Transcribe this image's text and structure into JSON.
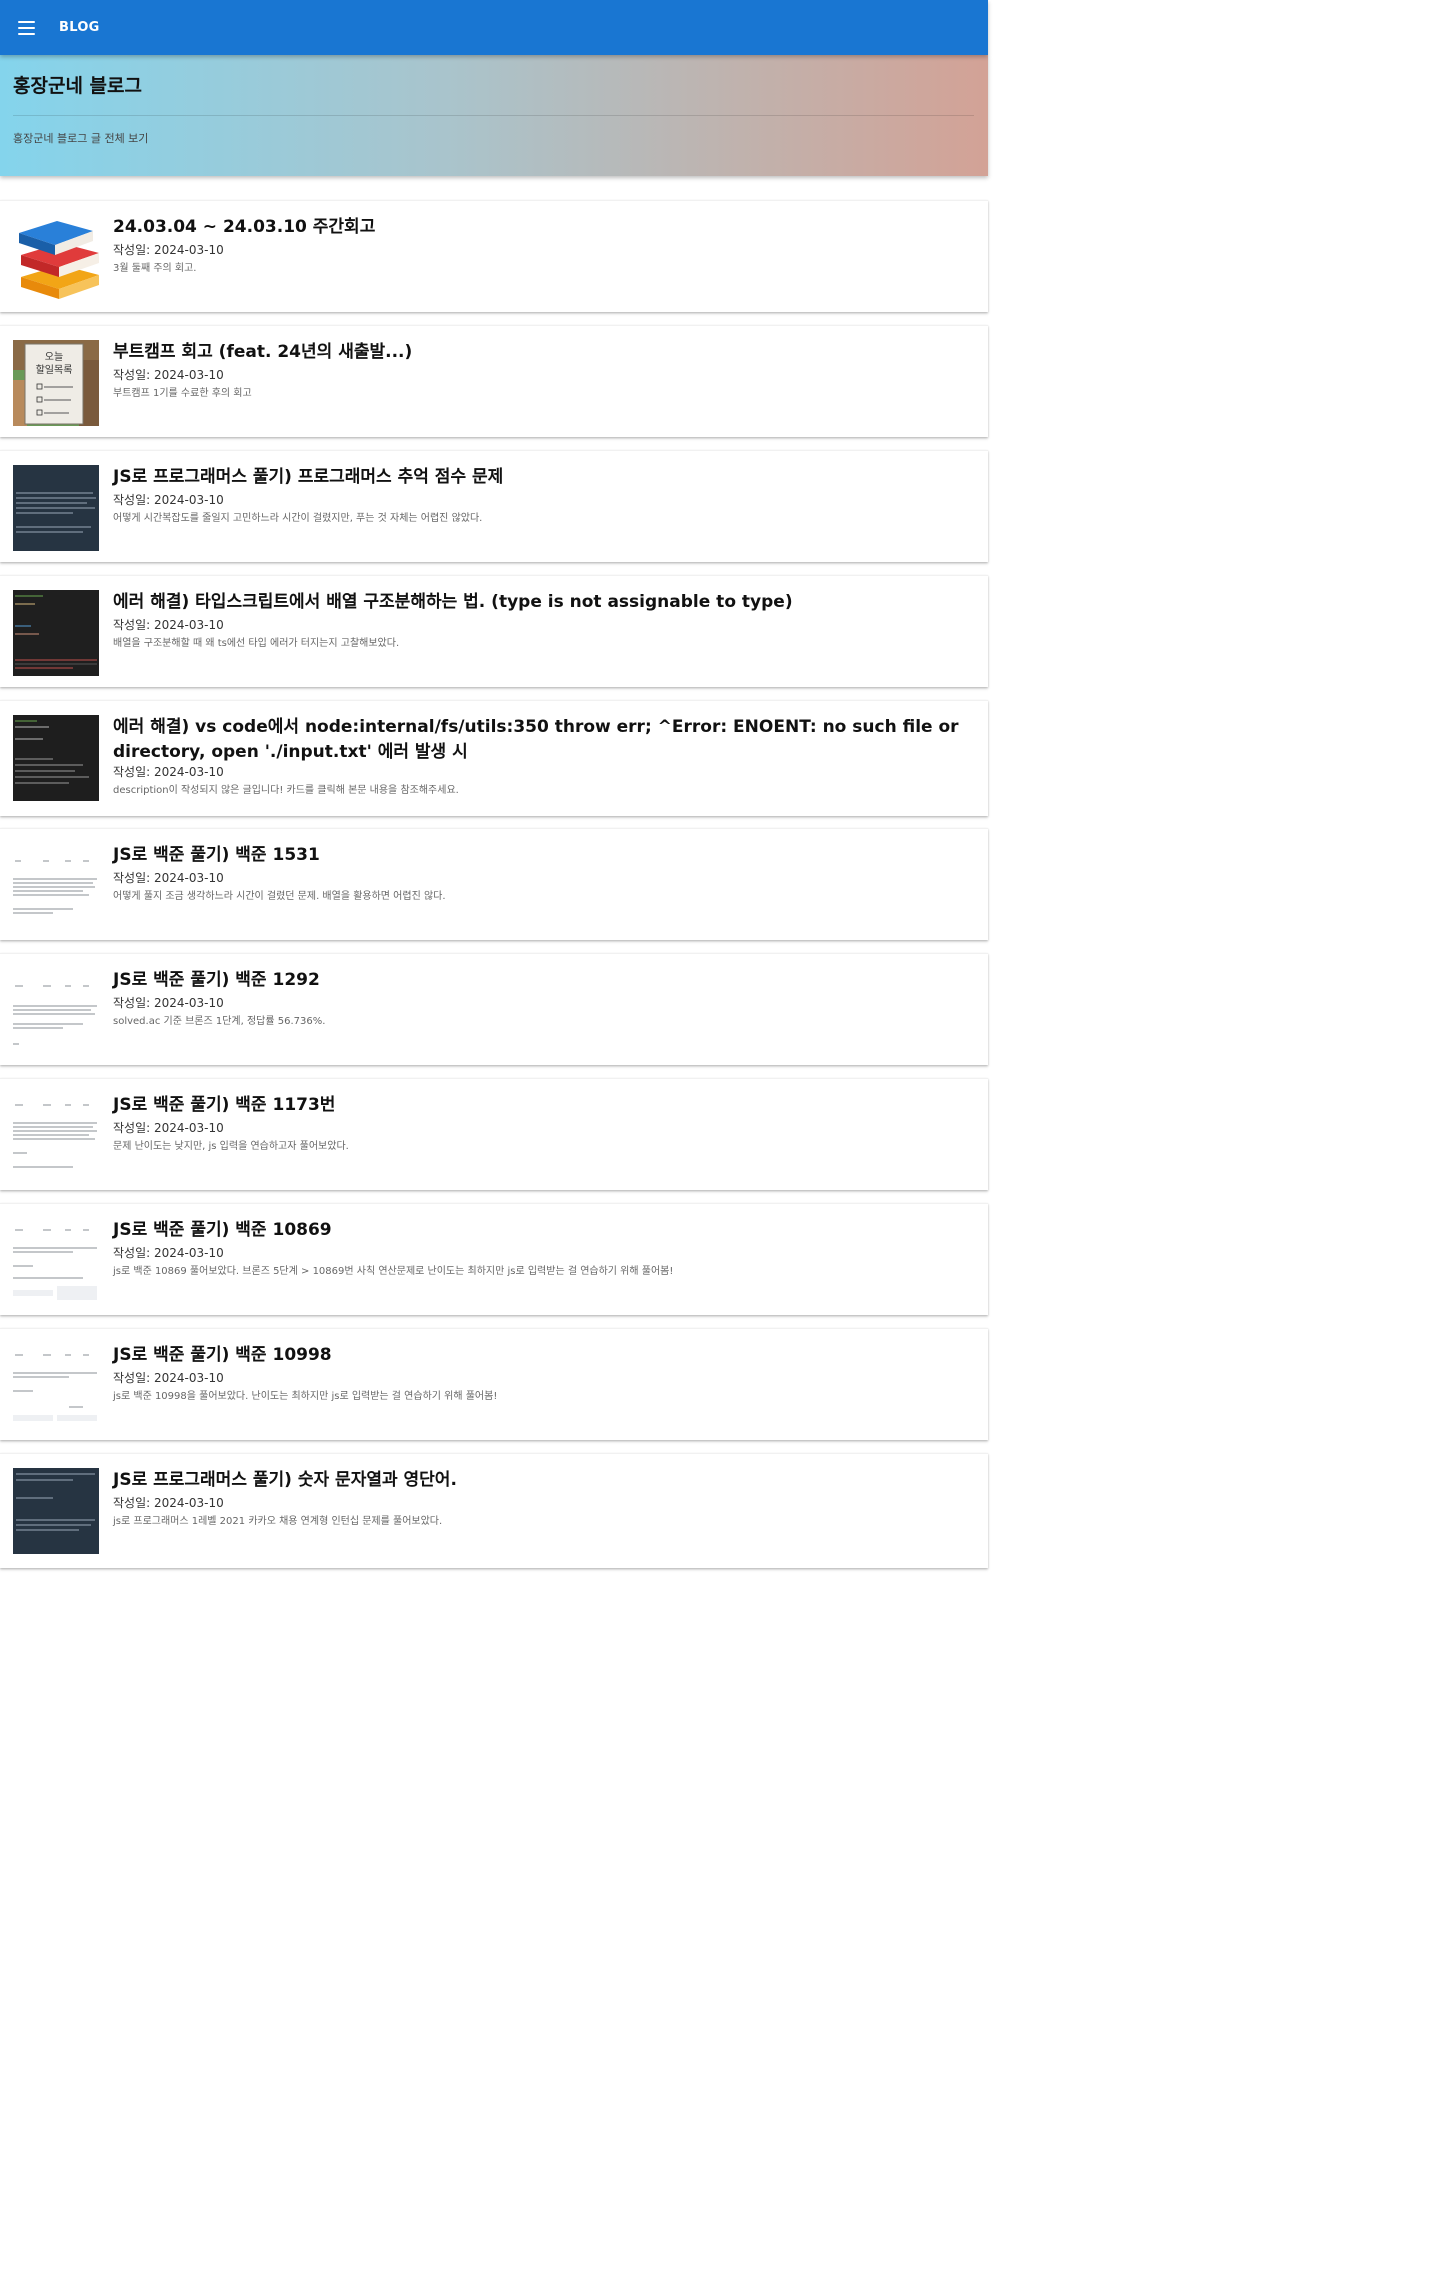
{
  "header": {
    "title": "BLOG",
    "menu_icon": "menu-icon"
  },
  "hero": {
    "title": "홍장군네 블로그",
    "link": "홍장군네 블로그 글 전체 보기",
    "colors": [
      "#84d4ec",
      "#d3a296"
    ]
  },
  "posts": [
    {
      "title": "24.03.04 ~ 24.03.10 주간회고",
      "date": "작성일: 2024-03-10",
      "description": "3월 둘째 주의 회고.",
      "thumbnail": "books-illustration"
    },
    {
      "title": "부트캠프 회고 (feat. 24년의 새출발...)",
      "date": "작성일: 2024-03-10",
      "description": "부트캠프 1기를 수료한 후의 회고",
      "thumbnail": "todo-list-illustration",
      "thumb_text": "오늘\n할일목록"
    },
    {
      "title": "JS로 프로그래머스 풀기) 프로그래머스 추억 점수 문제",
      "date": "작성일: 2024-03-10",
      "description": "어떻게 시간복잡도를 줄일지 고민하느라 시간이 걸렸지만, 푸는 것 자체는 어렵진 않았다.",
      "thumbnail": "dark-text-screenshot"
    },
    {
      "title": "에러 해결) 타입스크립트에서 배열 구조분해하는 법. (type is not assignable to type)",
      "date": "작성일: 2024-03-10",
      "description": "배열을 구조분해할 때 왜 ts에선 타입 에러가 터지는지 고찰해보았다.",
      "thumbnail": "code-editor-screenshot"
    },
    {
      "title": "에러 해결) vs code에서 node:internal/fs/utils:350 throw err; ^Error: ENOENT: no such file or directory, open './input.txt' 에러 발생 시",
      "date": "작성일: 2024-03-10",
      "description": "description이 작성되지 않은 글입니다! 카드를 클릭해 본문 내용을 참조해주세요.",
      "thumbnail": "terminal-screenshot"
    },
    {
      "title": "JS로 백준 풀기) 백준 1531",
      "date": "작성일: 2024-03-10",
      "description": "어떻게 풀지 조금 생각하느라 시간이 걸렸던 문제. 배열을 활용하면 어렵진 않다.",
      "thumbnail": "problem-page-screenshot"
    },
    {
      "title": "JS로 백준 풀기) 백준 1292",
      "date": "작성일: 2024-03-10",
      "description": "solved.ac 기준 브론즈 1단계, 정답률 56.736%.",
      "thumbnail": "problem-page-screenshot"
    },
    {
      "title": "JS로 백준 풀기) 백준 1173번",
      "date": "작성일: 2024-03-10",
      "description": "문제 난이도는 낮지만, js 입력을 연습하고자 풀어보았다.",
      "thumbnail": "problem-page-screenshot"
    },
    {
      "title": "JS로 백준 풀기) 백준 10869",
      "date": "작성일: 2024-03-10",
      "description": "js로 백준 10869 풀어보았다. 브론즈 5단계 > 10869번 사칙 연산문제로 난이도는 최하지만 js로 입력받는 걸 연습하기 위해 풀어봄!",
      "thumbnail": "problem-page-screenshot"
    },
    {
      "title": "JS로 백준 풀기) 백준 10998",
      "date": "작성일: 2024-03-10",
      "description": "js로 백준 10998을 풀어보았다. 난이도는 최하지만 js로 입력받는 걸 연습하기 위해 풀어봄!",
      "thumbnail": "problem-page-screenshot"
    },
    {
      "title": "JS로 프로그래머스 풀기) 숫자 문자열과 영단어.",
      "date": "작성일: 2024-03-10",
      "description": "js로 프로그래머스 1레벨 2021 카카오 채용 연계형 인턴십 문제를 풀어보았다.",
      "thumbnail": "dark-text-screenshot"
    }
  ]
}
